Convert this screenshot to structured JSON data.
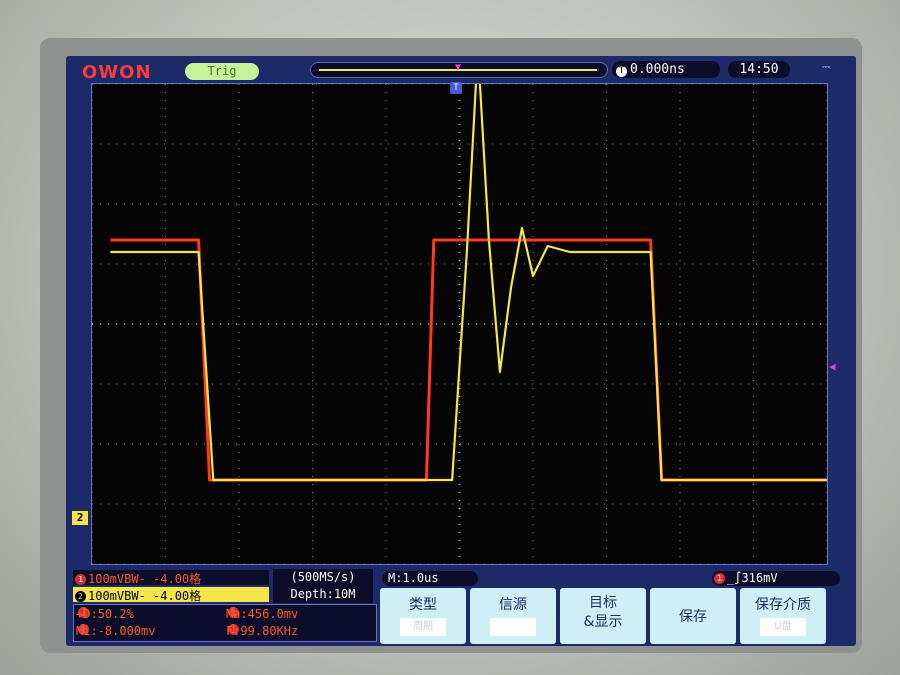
{
  "header": {
    "logo": "OWON",
    "trigger_status": "Trig",
    "trigger_delay": "0.000ns",
    "trigger_delay_icon": "T",
    "trigger_position_marker": "T",
    "time": "14:50"
  },
  "channels": {
    "ch1": {
      "id": "1",
      "text": "100mVBW- -4.00格",
      "color": "#ff3b1a"
    },
    "ch2": {
      "id": "2",
      "text": "100mVBW- -4.00格",
      "color": "#f4e64a"
    }
  },
  "acquisition": {
    "sample_rate": "(500MS/s)",
    "depth": "Depth:10M"
  },
  "timebase": "M:1.0us",
  "trigger": {
    "channel": "1",
    "level": "316mV"
  },
  "measurements": {
    "duty": "+D:50.2%",
    "max": "Ma:456.0mv",
    "min": "Mi:-8.000mv",
    "freq": "F:99.80KHz",
    "badge_icon": "1"
  },
  "menu": [
    {
      "label": "类型",
      "sub": "周期"
    },
    {
      "label": "信源",
      "sub": ""
    },
    {
      "label": "目标\n&显示",
      "sub": ""
    },
    {
      "label": "保存",
      "sub": ""
    },
    {
      "label": "保存介质",
      "sub": "U盘"
    }
  ],
  "chart_data": {
    "type": "line",
    "series": [
      {
        "color": "#ff3b1a",
        "x": [
          -4.75,
          -3.55,
          -3.4,
          -2.3,
          -0.45,
          -0.35,
          2.6,
          2.75,
          3.6,
          5.0
        ],
        "y": [
          1.4,
          1.4,
          -2.6,
          -2.6,
          -2.6,
          1.4,
          1.4,
          -2.6,
          -2.6,
          -2.6
        ]
      },
      {
        "color": "#f4e64a",
        "x": [
          -4.75,
          -3.55,
          -3.35,
          -2.3,
          -0.1,
          0.1,
          0.25,
          0.4,
          0.55,
          0.7,
          0.85,
          1.0,
          1.2,
          1.5,
          2.6,
          2.75,
          3.6,
          5.0
        ],
        "y": [
          1.2,
          1.2,
          -2.6,
          -2.6,
          -2.6,
          1.2,
          4.6,
          1.4,
          -0.8,
          0.6,
          1.6,
          0.8,
          1.3,
          1.2,
          1.2,
          -2.6,
          -2.6,
          -2.6
        ]
      }
    ],
    "xlim": [
      -5,
      5
    ],
    "ylim": [
      -4,
      4
    ],
    "grid": true
  }
}
